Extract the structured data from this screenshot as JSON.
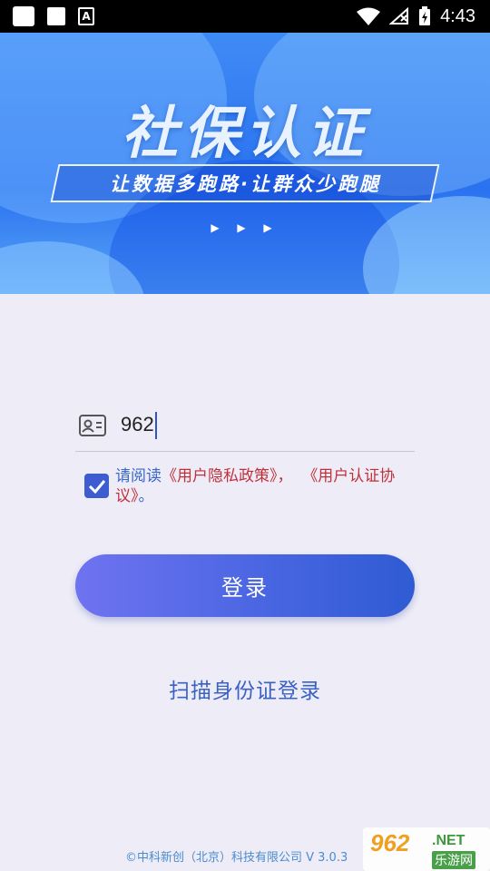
{
  "status_bar": {
    "time": "4:43",
    "icons": [
      "app-square-icon",
      "app-square-icon",
      "font-a-icon",
      "wifi-icon",
      "no-signal-icon",
      "battery-charging-icon"
    ]
  },
  "banner": {
    "title": "社保认证",
    "slogan": "让数据多跑路·让群众少跑腿",
    "indicator": "▶ ▶ ▶"
  },
  "login_form": {
    "id_input": {
      "value": "962",
      "icon": "id-card-icon"
    },
    "agreement": {
      "checked": true,
      "prefix": "请阅读",
      "privacy_link": "《用户隐私政策》",
      "separator": "，  ",
      "terms_link": "《用户认证协议》",
      "suffix": "。"
    },
    "login_button": "登录",
    "scan_link": "扫描身份证登录"
  },
  "footer": {
    "copyright": "©中科新创（北京）科技有限公司   V 3.0.3"
  },
  "watermark": {
    "number": "962",
    "net": ".NET",
    "name": "乐游网"
  },
  "colors": {
    "accent": "#3c5ccf",
    "link_red": "#c0303a",
    "text_blue": "#3a66c9",
    "background": "#eeedf7"
  }
}
